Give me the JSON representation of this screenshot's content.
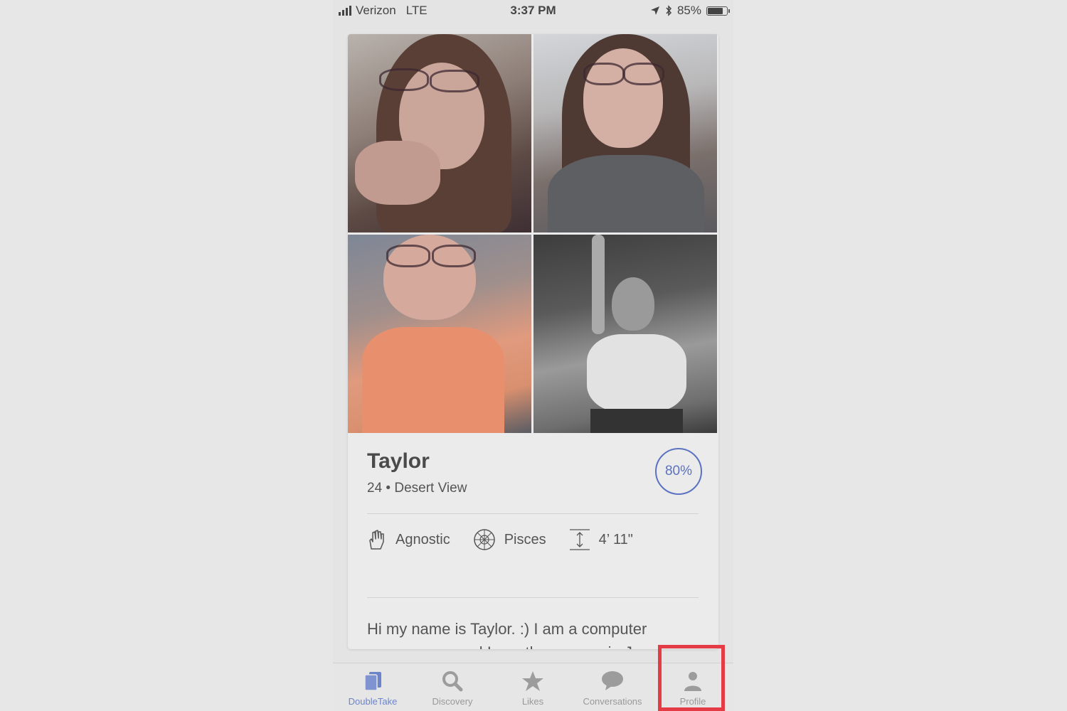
{
  "status_bar": {
    "carrier": "Verizon",
    "network": "LTE",
    "time": "3:37 PM",
    "battery": "85%",
    "battery_level": 0.85
  },
  "profile": {
    "name": "Taylor",
    "subline": "24 • Desert View",
    "match": "80%",
    "details": [
      {
        "icon": "raised-hand-icon",
        "label": "Agnostic"
      },
      {
        "icon": "zodiac-wheel-icon",
        "label": "Pisces"
      },
      {
        "icon": "height-icon",
        "label": "4’ 11\""
      }
    ],
    "bio": "Hi my name is Taylor. :) I am a computer programmer and I mostly program in Java."
  },
  "tabs": [
    {
      "label": "DoubleTake",
      "icon": "cards-icon",
      "active": true
    },
    {
      "label": "Discovery",
      "icon": "search-icon",
      "active": false
    },
    {
      "label": "Likes",
      "icon": "star-icon",
      "active": false
    },
    {
      "label": "Conversations",
      "icon": "speech-bubble-icon",
      "active": false
    },
    {
      "label": "Profile",
      "icon": "person-icon",
      "active": false
    }
  ],
  "colors": {
    "accent": "#5b72c2",
    "highlight": "#e53b44"
  }
}
